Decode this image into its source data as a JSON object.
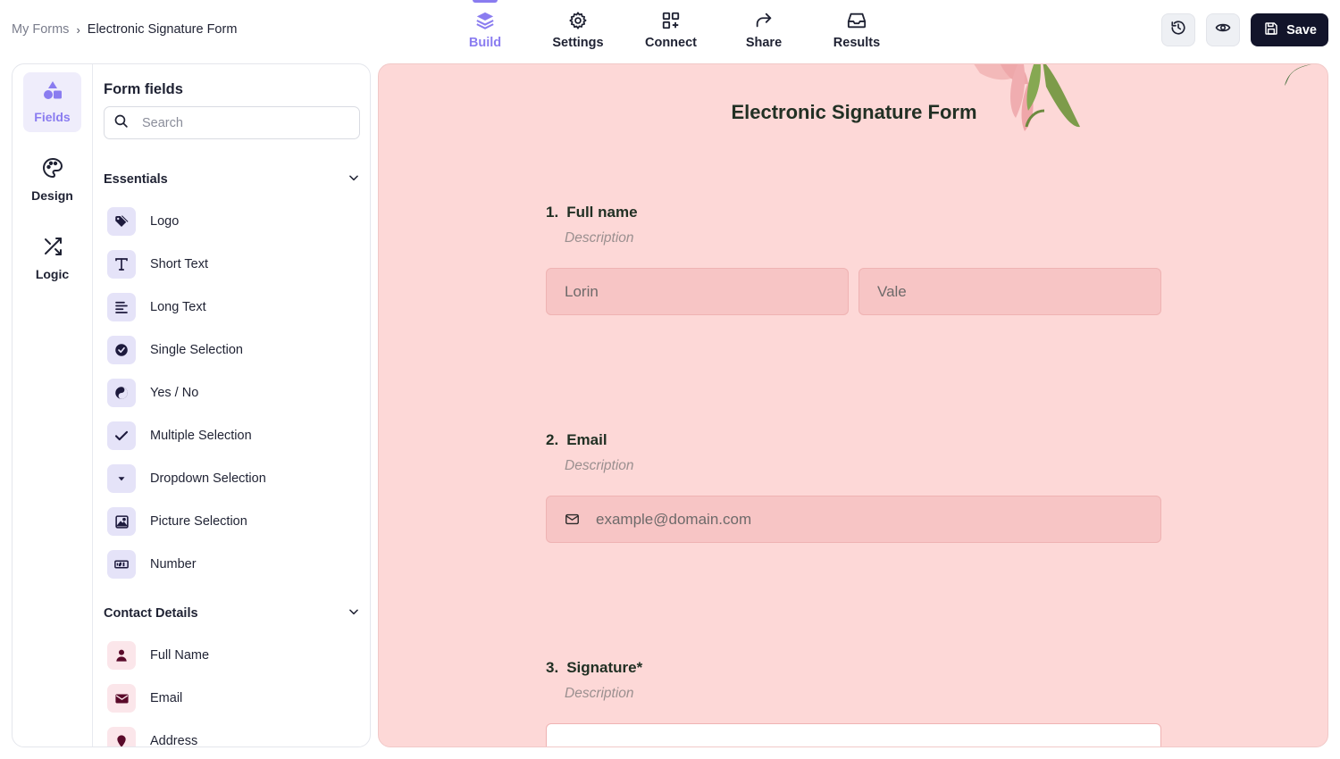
{
  "breadcrumb": {
    "parent": "My Forms",
    "separator": "›",
    "current": "Electronic Signature Form"
  },
  "topnav": [
    {
      "label": "Build",
      "icon": "layers-icon",
      "active": true
    },
    {
      "label": "Settings",
      "icon": "gear-icon"
    },
    {
      "label": "Connect",
      "icon": "grid-plus-icon"
    },
    {
      "label": "Share",
      "icon": "share-arrow-icon"
    },
    {
      "label": "Results",
      "icon": "inbox-icon"
    }
  ],
  "actions": {
    "history_icon": "history-icon",
    "preview_icon": "eye-icon",
    "save_label": "Save"
  },
  "rail": [
    {
      "label": "Fields",
      "icon": "shapes-icon",
      "active": true
    },
    {
      "label": "Design",
      "icon": "palette-icon"
    },
    {
      "label": "Logic",
      "icon": "shuffle-icon"
    }
  ],
  "fields_panel": {
    "title": "Form fields",
    "search_placeholder": "Search",
    "groups": [
      {
        "label": "Essentials",
        "items": [
          {
            "label": "Logo",
            "icon": "tag-icon"
          },
          {
            "label": "Short Text",
            "icon": "text-t-icon"
          },
          {
            "label": "Long Text",
            "icon": "align-left-icon"
          },
          {
            "label": "Single Selection",
            "icon": "check-circle-icon"
          },
          {
            "label": "Yes / No",
            "icon": "yin-yang-icon"
          },
          {
            "label": "Multiple Selection",
            "icon": "checkmark-icon"
          },
          {
            "label": "Dropdown Selection",
            "icon": "caret-down-icon"
          },
          {
            "label": "Picture Selection",
            "icon": "image-icon"
          },
          {
            "label": "Number",
            "icon": "number-input-icon"
          }
        ]
      },
      {
        "label": "Contact Details",
        "items": [
          {
            "label": "Full Name",
            "icon": "person-icon"
          },
          {
            "label": "Email",
            "icon": "envelope-icon"
          },
          {
            "label": "Address",
            "icon": "location-icon"
          }
        ]
      }
    ]
  },
  "form": {
    "title": "Electronic Signature Form",
    "questions": [
      {
        "number": "1.",
        "label": "Full name",
        "description": "Description",
        "inputs": [
          "Lorin",
          "Vale"
        ]
      },
      {
        "number": "2.",
        "label": "Email",
        "description": "Description",
        "placeholder": "example@domain.com"
      },
      {
        "number": "3.",
        "label": "Signature*",
        "description": "Description"
      }
    ]
  },
  "colors": {
    "accent": "#8a7cf0",
    "canvas": "#fdd8d7",
    "input": "#f7c5c5",
    "title": "#213024",
    "save_bg": "#12142a"
  }
}
